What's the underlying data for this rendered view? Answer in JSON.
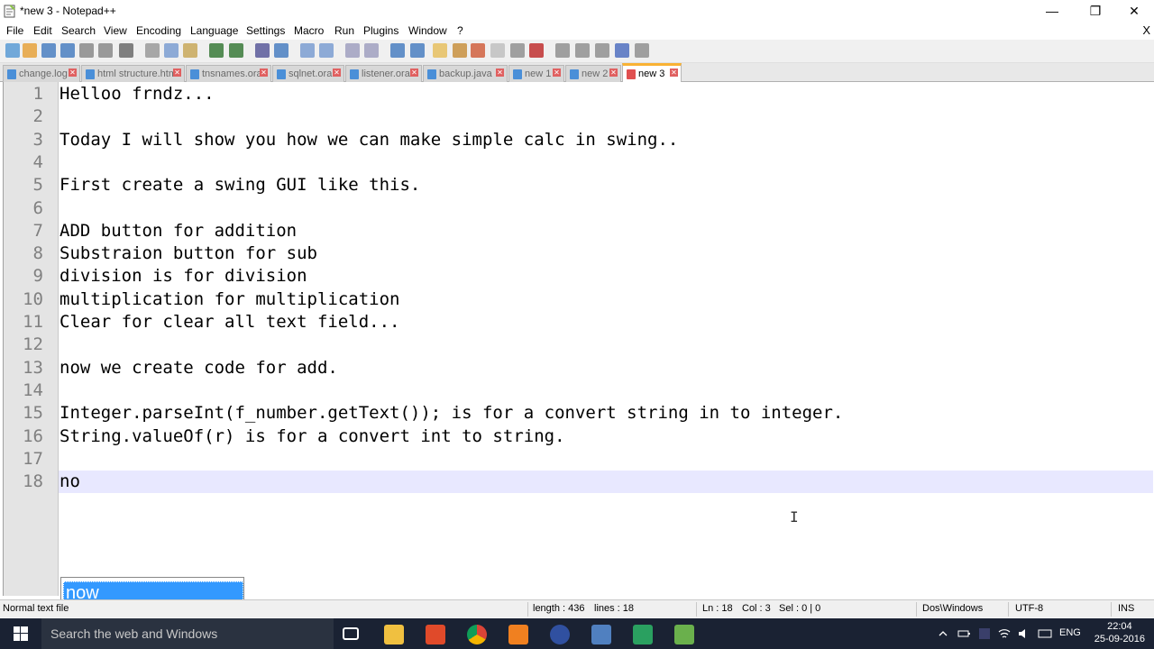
{
  "window": {
    "title": "*new 3 - Notepad++",
    "minimize_glyph": "—",
    "restore_glyph": "❐",
    "close_glyph": "✕"
  },
  "menu": {
    "items": [
      "File",
      "Edit",
      "Search",
      "View",
      "Encoding",
      "Language",
      "Settings",
      "Macro",
      "Run",
      "Plugins",
      "Window",
      "?"
    ],
    "doc_close": "X"
  },
  "toolbar": {
    "icons": [
      "new-file-icon",
      "open-file-icon",
      "save-icon",
      "save-all-icon",
      "close-icon",
      "close-all-icon",
      "print-icon",
      "cut-icon",
      "copy-icon",
      "paste-icon",
      "undo-icon",
      "redo-icon",
      "find-icon",
      "replace-icon",
      "zoom-in-icon",
      "zoom-out-icon",
      "sync-v-icon",
      "sync-h-icon",
      "word-wrap-icon",
      "show-all-chars-icon",
      "indent-guide-icon",
      "udl-icon",
      "doc-map-icon",
      "function-list-icon",
      "folder-workspace-icon",
      "monitor-icon",
      "record-macro-icon",
      "stop-record-icon",
      "play-macro-icon",
      "run-macro-multiple-icon",
      "save-macro-icon"
    ]
  },
  "tabs": [
    {
      "label": "change.log",
      "active": false
    },
    {
      "label": "html structure.html",
      "active": false
    },
    {
      "label": "tnsnames.ora",
      "active": false
    },
    {
      "label": "sqlnet.ora",
      "active": false
    },
    {
      "label": "listener.ora",
      "active": false
    },
    {
      "label": "backup.java",
      "active": false
    },
    {
      "label": "new 1",
      "active": false
    },
    {
      "label": "new 2",
      "active": false
    },
    {
      "label": "new 3",
      "active": true
    }
  ],
  "editor": {
    "line_numbers": [
      "1",
      "2",
      "3",
      "4",
      "5",
      "6",
      "7",
      "8",
      "9",
      "10",
      "11",
      "12",
      "13",
      "14",
      "15",
      "16",
      "17",
      "18"
    ],
    "lines": [
      "Helloo frndz...",
      "",
      "Today I will show you how we can make simple calc in swing..",
      "",
      "First create a swing GUI like this.",
      "",
      "ADD button for addition",
      "Substraion button for sub",
      "division is for division",
      "multiplication for multiplication",
      "Clear for clear all text field...",
      "",
      "now we create code for add.",
      "",
      "Integer.parseInt(f_number.getText()); is for a convert string in to integer.",
      "String.valueOf(r) is for a convert int to string.",
      "",
      "no"
    ],
    "current_line": 18,
    "autocomplete": {
      "suggestion": "now"
    },
    "cursor_glyph": "I"
  },
  "status": {
    "file_type": "Normal text file",
    "length": "length : 436",
    "lines": "lines : 18",
    "ln": "Ln : 18",
    "col": "Col : 3",
    "sel": "Sel : 0 | 0",
    "eol": "Dos\\Windows",
    "encoding": "UTF-8",
    "ins": "INS"
  },
  "taskbar": {
    "search_placeholder": "Search the web and Windows",
    "apps": [
      "task-view-icon",
      "file-explorer-icon",
      "store-icon",
      "chrome-icon",
      "vlc-icon",
      "eclipse-icon",
      "virtualbox-icon",
      "edge-icon",
      "notepadpp-icon"
    ],
    "language": "ENG",
    "time": "22:04",
    "date": "25-09-2016"
  },
  "colors": {
    "selection": "#3399ff",
    "current_line": "#e8e8ff",
    "active_tab_accent": "#f9b234",
    "taskbar": "#1a2233"
  }
}
